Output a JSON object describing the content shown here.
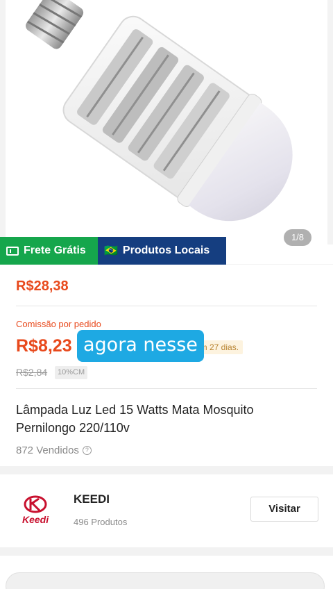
{
  "gallery": {
    "counter": "1/8"
  },
  "badges": {
    "frete": "Frete Grátis",
    "locais": "Produtos Locais",
    "flag": "🇧🇷"
  },
  "pricing": {
    "price": "R$28,38",
    "commission_label": "Comissão por pedido",
    "commission_value": "R$8,23",
    "remaining": "ltam 27 dias.",
    "old_price": "R$2,84",
    "percent_tag": "10%CM"
  },
  "caption": "agora nesse",
  "product": {
    "title": "Lâmpada Luz Led 15 Watts Mata Mosquito Pernilongo 220/110v",
    "sold": "872 Vendidos",
    "info_icon": "?"
  },
  "store": {
    "logo_text": "Keedi",
    "name": "KEEDI",
    "products": "496 Produtos",
    "visit_label": "Visitar"
  },
  "colors": {
    "accent": "#e8491c",
    "frete_green": "#15a64c",
    "locais_blue": "#153e80",
    "caption_blue": "#1ea9e3",
    "brand_red": "#c8102e"
  }
}
